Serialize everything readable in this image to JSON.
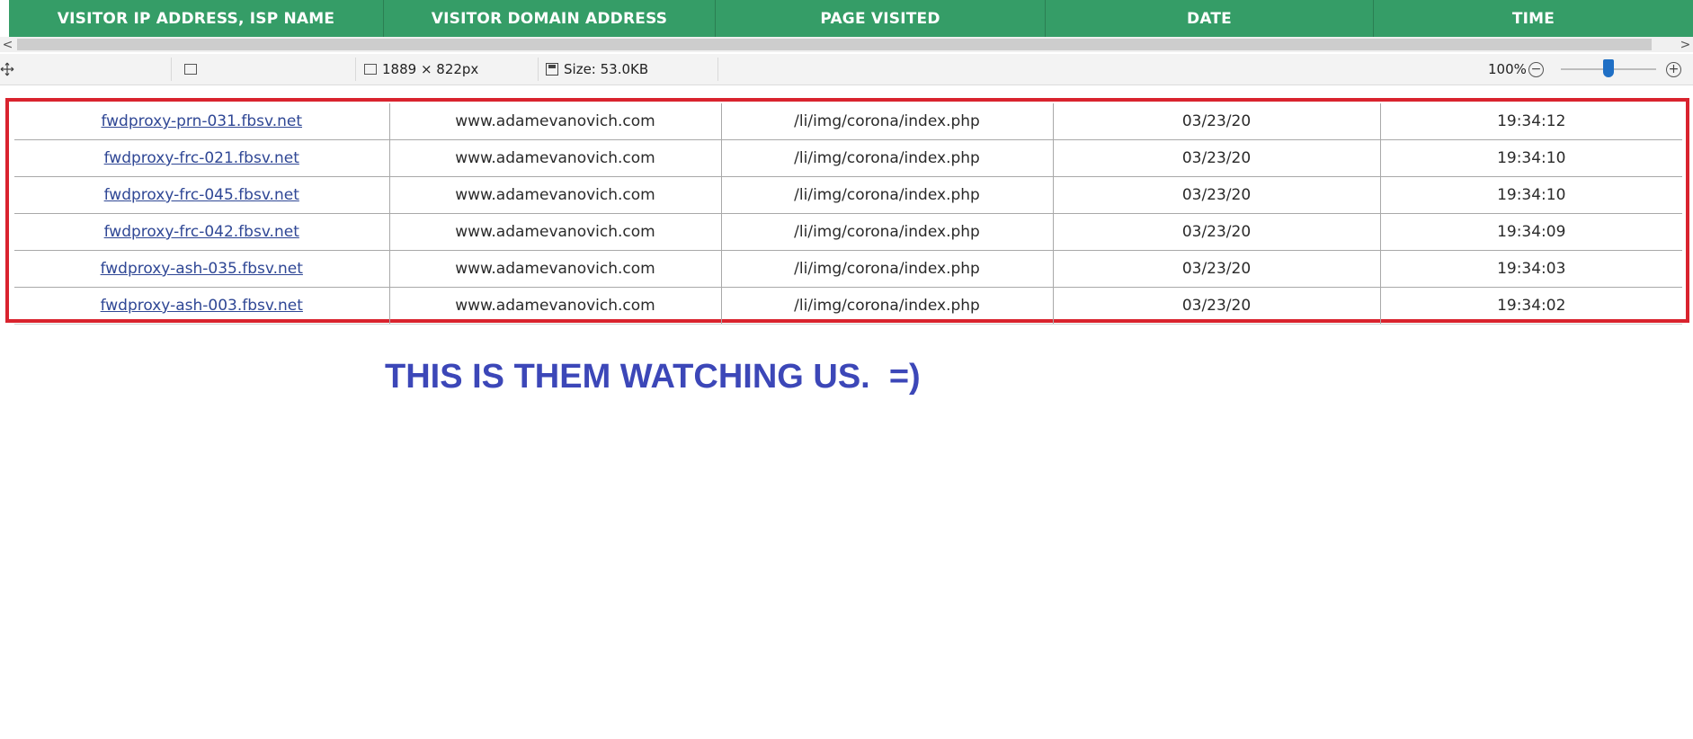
{
  "header": {
    "columns": [
      "VISITOR IP ADDRESS, ISP NAME",
      "VISITOR DOMAIN ADDRESS",
      "PAGE VISITED",
      "DATE",
      "TIME"
    ]
  },
  "scrollbar": {
    "left_arrow": "<",
    "right_arrow": ">"
  },
  "statusbar": {
    "dimensions": "1889 × 822px",
    "size": "Size: 53.0KB",
    "zoom": "100%",
    "zoom_out": "−",
    "zoom_in": "+",
    "slider_fraction": 0.5
  },
  "rows": [
    {
      "isp": "fwdproxy-prn-031.fbsv.net",
      "domain": "www.adamevanovich.com",
      "page": "/li/img/corona/index.php",
      "date": "03/23/20",
      "time": "19:34:12"
    },
    {
      "isp": "fwdproxy-frc-021.fbsv.net",
      "domain": "www.adamevanovich.com",
      "page": "/li/img/corona/index.php",
      "date": "03/23/20",
      "time": "19:34:10"
    },
    {
      "isp": "fwdproxy-frc-045.fbsv.net",
      "domain": "www.adamevanovich.com",
      "page": "/li/img/corona/index.php",
      "date": "03/23/20",
      "time": "19:34:10"
    },
    {
      "isp": "fwdproxy-frc-042.fbsv.net",
      "domain": "www.adamevanovich.com",
      "page": "/li/img/corona/index.php",
      "date": "03/23/20",
      "time": "19:34:09"
    },
    {
      "isp": "fwdproxy-ash-035.fbsv.net",
      "domain": "www.adamevanovich.com",
      "page": "/li/img/corona/index.php",
      "date": "03/23/20",
      "time": "19:34:03"
    },
    {
      "isp": "fwdproxy-ash-003.fbsv.net",
      "domain": "www.adamevanovich.com",
      "page": "/li/img/corona/index.php",
      "date": "03/23/20",
      "time": "19:34:02"
    }
  ],
  "caption": "THIS IS THEM WATCHING US.  =)",
  "colors": {
    "header_green": "#359d67",
    "frame_red": "#d9232e",
    "caption_blue": "#3c47b8",
    "link_blue": "#2f4795"
  }
}
